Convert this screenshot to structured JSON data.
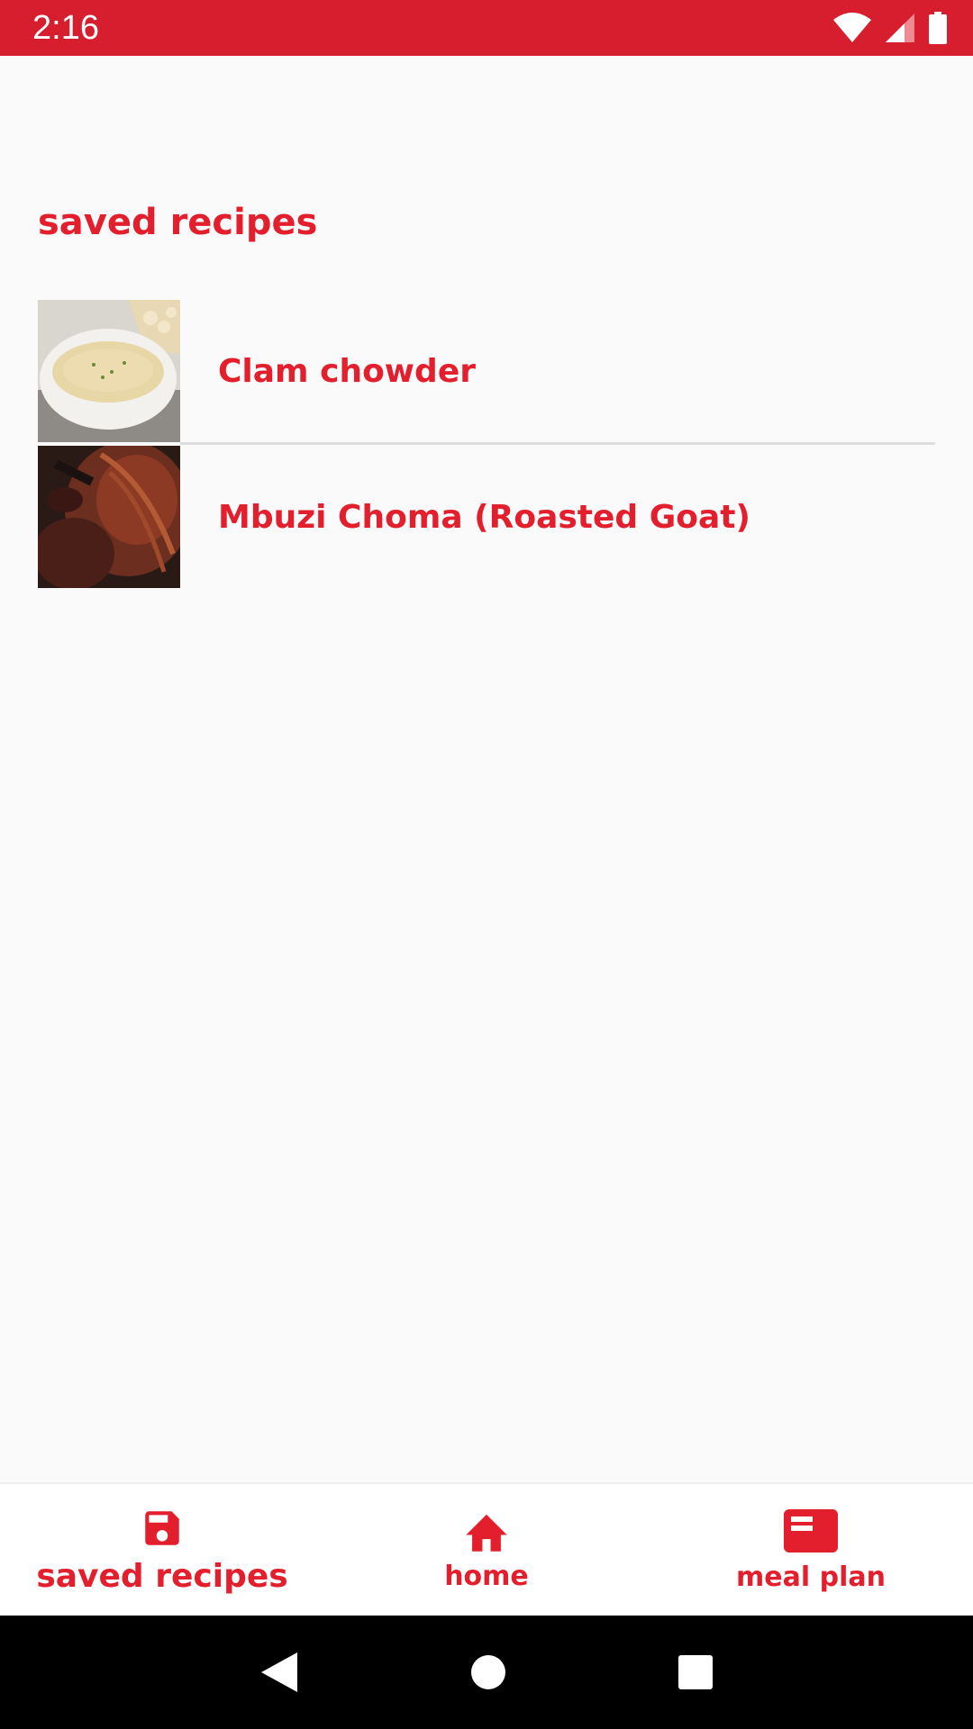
{
  "status_bar": {
    "time": "2:16",
    "icons": [
      "wifi-icon",
      "cell-signal-icon",
      "battery-icon"
    ]
  },
  "colors": {
    "accent": "#e41f2d",
    "status_bar": "#d61e2e",
    "background": "#fafafa"
  },
  "page": {
    "title": "saved recipes"
  },
  "recipes": [
    {
      "name": "Clam chowder",
      "thumbnail": "soup-bowl-image"
    },
    {
      "name": "Mbuzi Choma (Roasted Goat)",
      "thumbnail": "roasted-meat-image"
    }
  ],
  "bottom_nav": {
    "items": [
      {
        "label": "saved recipes",
        "icon": "save-disk-icon",
        "active": true
      },
      {
        "label": "home",
        "icon": "home-icon",
        "active": false
      },
      {
        "label": "meal plan",
        "icon": "meal-plan-icon",
        "active": false
      }
    ]
  },
  "system_nav": {
    "icons": [
      "back-icon",
      "home-circle-icon",
      "recents-icon"
    ]
  }
}
